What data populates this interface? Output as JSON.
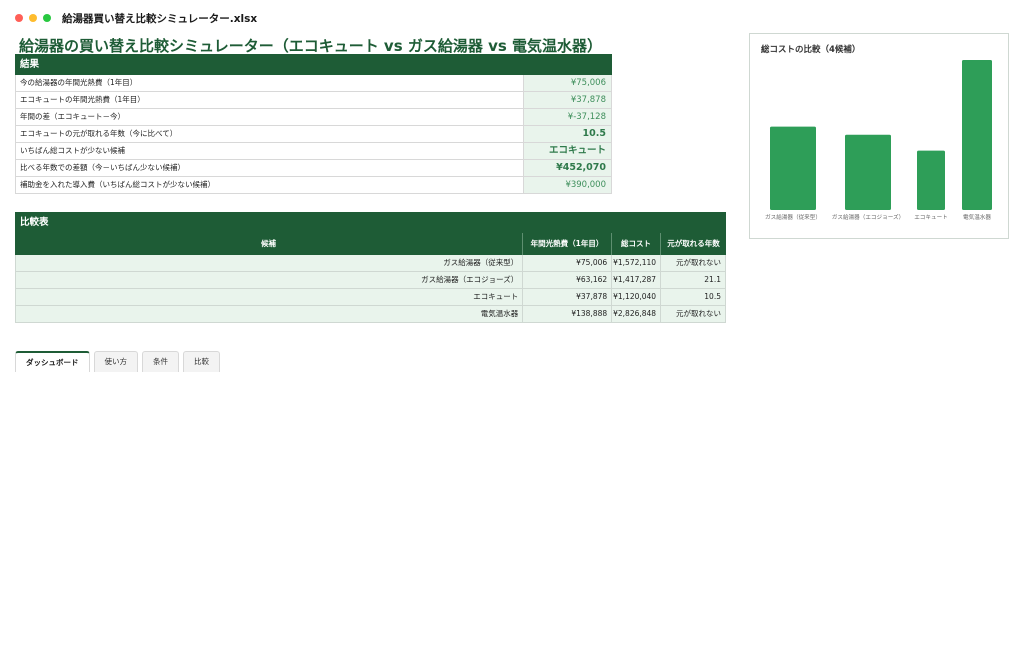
{
  "window": {
    "filename": "給湯器買い替え比較シミュレーター.xlsx"
  },
  "sheet_title": "給湯器の買い替え比較シミュレーター（エコキュート vs ガス給湯器 vs 電気温水器）",
  "result": {
    "header": "結果",
    "rows": [
      {
        "label": "今の給湯器の年間光熱費（1年目）",
        "value": "¥75,006"
      },
      {
        "label": "エコキュートの年間光熱費（1年目）",
        "value": "¥37,878"
      },
      {
        "label": "年間の差（エコキュート－今）",
        "value": "¥-37,128"
      },
      {
        "label": "エコキュートの元が取れる年数（今に比べて）",
        "value": "10.5"
      },
      {
        "label": "いちばん総コストが少ない候補",
        "value": "エコキュート"
      },
      {
        "label": "比べる年数での差額（今－いちばん少ない候補）",
        "value": "¥452,070"
      },
      {
        "label": "補助金を入れた導入費（いちばん総コストが少ない候補）",
        "value": "¥390,000"
      }
    ]
  },
  "compare": {
    "header": "比較表",
    "columns": [
      "候補",
      "年間光熱費（1年目）",
      "総コスト",
      "元が取れる年数"
    ],
    "rows": [
      {
        "name": "ガス給湯器（従来型）",
        "annual": "¥75,006",
        "total": "¥1,572,110",
        "payback": "元が取れない"
      },
      {
        "name": "ガス給湯器（エコジョーズ）",
        "annual": "¥63,162",
        "total": "¥1,417,287",
        "payback": "21.1"
      },
      {
        "name": "エコキュート",
        "annual": "¥37,878",
        "total": "¥1,120,040",
        "payback": "10.5"
      },
      {
        "name": "電気温水器",
        "annual": "¥138,888",
        "total": "¥2,826,848",
        "payback": "元が取れない"
      }
    ]
  },
  "tabs": [
    "ダッシュボード",
    "使い方",
    "条件",
    "比較"
  ],
  "active_tab": "ダッシュボード",
  "colors": {
    "accent": "#1e5c36",
    "bar": "#2e9e58",
    "value_bg": "#e9f4ec"
  },
  "chart_data": {
    "type": "bar",
    "title": "総コストの比較（4候補）",
    "categories": [
      "ガス給湯器（従来型）",
      "ガス給湯器（エコジョーズ）",
      "エコキュート",
      "電気温水器"
    ],
    "values": [
      1572110,
      1417287,
      1120040,
      2826848
    ],
    "ylim": [
      0,
      2826848
    ],
    "grid": false,
    "legend": "none"
  }
}
